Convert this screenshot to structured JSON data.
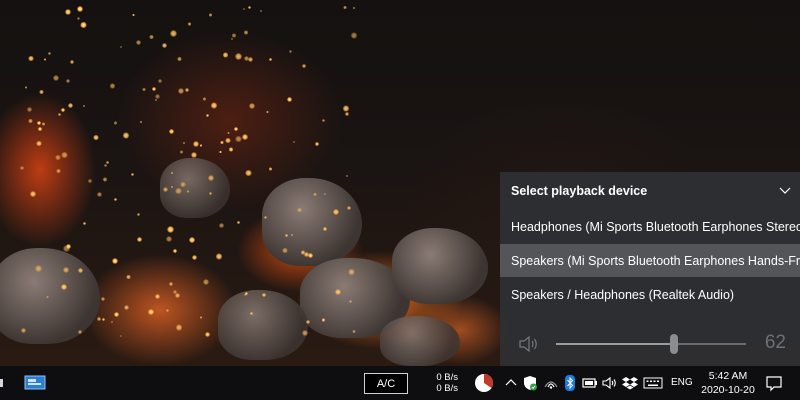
{
  "playback_flyout": {
    "title": "Select playback device",
    "devices": [
      {
        "label": "Headphones (Mi Sports Bluetooth Earphones Stereo)",
        "selected": false
      },
      {
        "label": "Speakers (Mi Sports Bluetooth Earphones Hands-Free)",
        "selected": true
      },
      {
        "label": "Speakers / Headphones (Realtek Audio)",
        "selected": false
      }
    ],
    "volume": 62,
    "volume_label": "62"
  },
  "taskbar": {
    "ac_label": "A/C",
    "net_upload": "0 B/s",
    "net_download": "0 B/s",
    "language": "ENG",
    "time": "5:42 AM",
    "date": "2020-10-20",
    "tray_icons": [
      "show-hidden-icons-chevron",
      "windows-security-icon",
      "wifi-icon",
      "bluetooth-icon",
      "battery-icon",
      "volume-icon",
      "dropbox-icon",
      "touch-keyboard-icon"
    ]
  },
  "colors": {
    "flyout_bg": "#2e3034",
    "selected_row": "#6e7074",
    "taskbar_bg": "#0e0e10"
  }
}
